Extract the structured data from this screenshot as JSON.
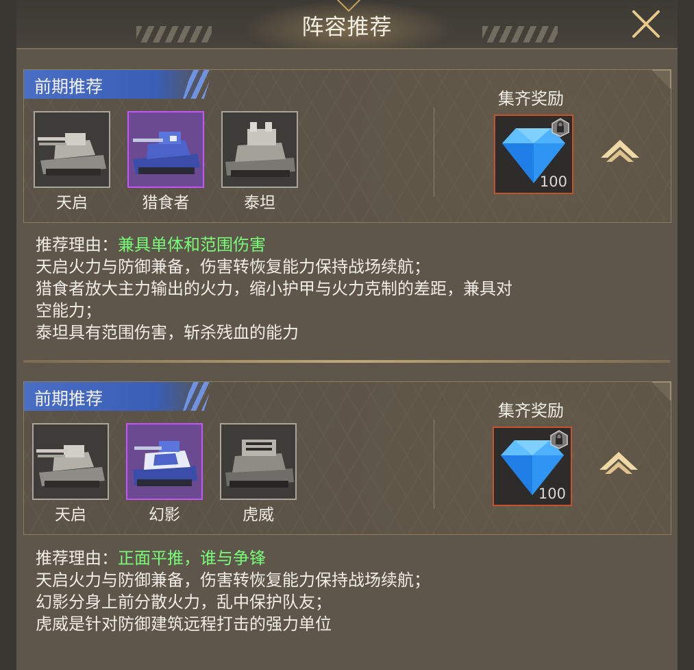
{
  "window": {
    "title": "阵容推荐"
  },
  "sections": [
    {
      "tag": "前期推荐",
      "units": [
        {
          "name": "天启",
          "rarity": "gray"
        },
        {
          "name": "猎食者",
          "rarity": "purple"
        },
        {
          "name": "泰坦",
          "rarity": "gray"
        }
      ],
      "reward": {
        "label": "集齐奖励",
        "icon": "blue-diamond-icon",
        "count": "100",
        "locked": true
      },
      "reason_label": "推荐理由：",
      "reason_highlight": "兼具单体和范围伤害",
      "lines": [
        "天启火力与防御兼备，伤害转恢复能力保持战场续航；",
        "猎食者放大主力输出的火力，缩小护甲与火力克制的差距，兼具对",
        "空能力；",
        "泰坦具有范围伤害，斩杀残血的能力"
      ]
    },
    {
      "tag": "前期推荐",
      "units": [
        {
          "name": "天启",
          "rarity": "gray"
        },
        {
          "name": "幻影",
          "rarity": "purple"
        },
        {
          "name": "虎威",
          "rarity": "gray"
        }
      ],
      "reward": {
        "label": "集齐奖励",
        "icon": "blue-diamond-icon",
        "count": "100",
        "locked": true
      },
      "reason_label": "推荐理由：",
      "reason_highlight": "正面平推，谁与争锋",
      "lines": [
        "天启火力与防御兼备，伤害转恢复能力保持战场续航；",
        "幻影分身上前分散火力，乱中保护队友；",
        "虎威是针对防御建筑远程打击的强力单位"
      ]
    }
  ],
  "colors": {
    "highlight": "#78ff78",
    "tag_blue": "#4a6ec4",
    "purple_frame": "#c456ff",
    "reward_frame": "#c4532e",
    "gold_accent": "#e8c98a"
  }
}
